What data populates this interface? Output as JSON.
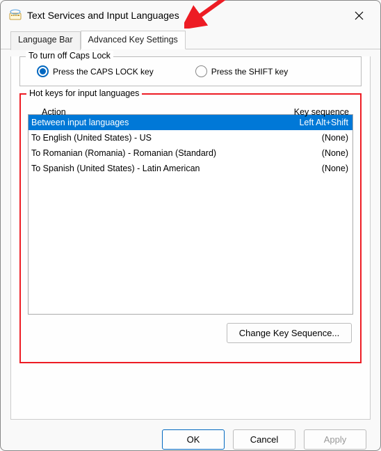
{
  "window": {
    "title": "Text Services and Input Languages"
  },
  "tabs": {
    "language_bar": "Language Bar",
    "advanced": "Advanced Key Settings"
  },
  "capslock": {
    "legend": "To turn off Caps Lock",
    "opt_caps": "Press the CAPS LOCK key",
    "opt_shift": "Press the SHIFT key",
    "selected": "opt_caps"
  },
  "hotkeys": {
    "legend": "Hot keys for input languages",
    "header_action": "Action",
    "header_seq": "Key sequence",
    "rows": [
      {
        "action": "Between input languages",
        "seq": "Left Alt+Shift",
        "selected": true
      },
      {
        "action": "To English (United States) - US",
        "seq": "(None)",
        "selected": false
      },
      {
        "action": "To Romanian (Romania) - Romanian (Standard)",
        "seq": "(None)",
        "selected": false
      },
      {
        "action": "To Spanish (United States) - Latin American",
        "seq": "(None)",
        "selected": false
      }
    ],
    "change_btn": "Change Key Sequence..."
  },
  "footer": {
    "ok": "OK",
    "cancel": "Cancel",
    "apply": "Apply"
  }
}
